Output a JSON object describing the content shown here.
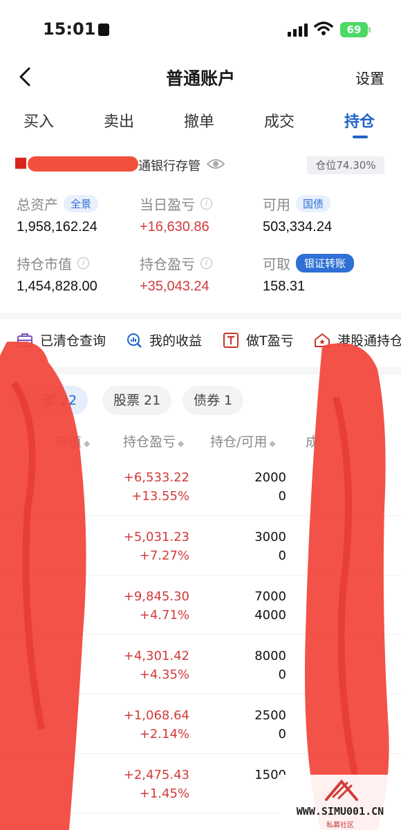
{
  "status_bar": {
    "time": "15:01",
    "battery": "69"
  },
  "nav": {
    "title": "普通账户",
    "settings": "设置"
  },
  "tabs": [
    "买入",
    "卖出",
    "撤单",
    "成交",
    "持仓"
  ],
  "account": {
    "bank_label": "通银行存管",
    "position_ratio": "仓位74.30%"
  },
  "metrics": {
    "total_assets": {
      "label": "总资产",
      "badge": "全景",
      "value": "1,958,162.24"
    },
    "daily_pl": {
      "label": "当日盈亏",
      "value": "+16,630.86"
    },
    "available": {
      "label": "可用",
      "badge": "国债",
      "value": "503,334.24"
    },
    "market_value": {
      "label": "持仓市值",
      "value": "1,454,828.00"
    },
    "position_pl": {
      "label": "持仓盈亏",
      "value": "+35,043.24"
    },
    "withdrawable": {
      "label": "可取",
      "badge": "银证转账",
      "value": "158.31"
    }
  },
  "shortcuts": [
    "已清仓查询",
    "我的收益",
    "做T盈亏",
    "港股通持仓"
  ],
  "filters": [
    "部 22",
    "股票 21",
    "债券 1"
  ],
  "table_headers": [
    "市值",
    "持仓盈亏",
    "持仓/可用",
    "成"
  ],
  "positions": [
    {
      "pl": "+6,533.22",
      "pl_pct": "+13.55%",
      "holding": "2000",
      "available": "0"
    },
    {
      "pl": "+5,031.23",
      "pl_pct": "+7.27%",
      "holding": "3000",
      "available": "0"
    },
    {
      "pl": "+9,845.30",
      "pl_pct": "+4.71%",
      "holding": "7000",
      "available": "4000"
    },
    {
      "pl": "+4,301.42",
      "pl_pct": "+4.35%",
      "holding": "8000",
      "available": "0"
    },
    {
      "pl": "+1,068.64",
      "pl_pct": "+2.14%",
      "holding": "2500",
      "available": "0"
    },
    {
      "pl": "+2,475.43",
      "pl_pct": "+1.45%",
      "holding": "1500",
      "available": ""
    }
  ],
  "watermark": {
    "site": "WWW.SIMU001.CN",
    "sub": "私募社区"
  },
  "colors": {
    "accent": "#1e62c8",
    "gain": "#d23a3a",
    "redaction": "#f2503c"
  }
}
